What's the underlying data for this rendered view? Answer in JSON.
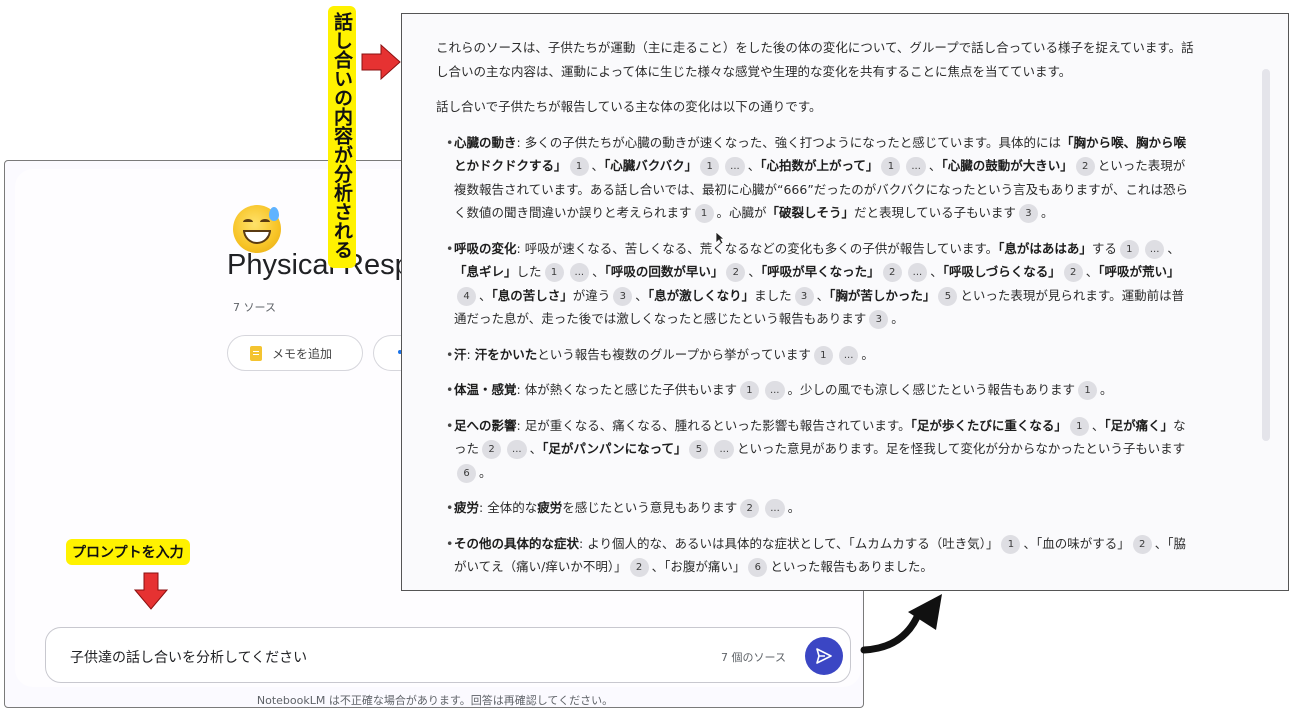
{
  "notebook": {
    "title": "Physical Resp",
    "source_count": "7 ソース",
    "memo_button": "メモを追加",
    "prompt": {
      "value": "子供達の話し合いを分析してください",
      "sources": "7 個のソース"
    },
    "disclaimer": "NotebookLM は不正確な場合があります。回答は再確認してください。"
  },
  "annotations": {
    "input_label": "プロンプトを入力",
    "analysis_label": "話し合いの内容が分析される"
  },
  "response": {
    "intro": "これらのソースは、子供たちが運動（主に走ること）をした後の体の変化について、グループで話し合っている様子を捉えています。話し合いの主な内容は、運動によって体に生じた様々な感覚や生理的な変化を共有することに焦点を当てています。",
    "lead": "話し合いで子供たちが報告している主な体の変化は以下の通りです。",
    "heart": {
      "head": "心臓の動き",
      "t1": ": 多くの子供たちが心臓の動きが速くなった、強く打つようになったと感じています。具体的には",
      "q1": "「胸から喉、胸から喉とかドクドクする」",
      "c1": "1",
      "t2": "、",
      "q2": "「心臓バクバク」",
      "c2": "1",
      "c2b": "...",
      "t3": "、",
      "q3": "「心拍数が上がって」",
      "c3": "1",
      "c3b": "...",
      "t4": "、",
      "q4": "「心臓の鼓動が大きい」",
      "c4": "2",
      "t5": "といった表現が複数報告されています。ある話し合いでは、最初に心臓が“666”だったのがバクバクになったという言及もありますが、これは恐らく数値の聞き間違いか誤りと考えられます",
      "c5": "1",
      "t6": "。心臓が",
      "q5": "「破裂しそう」",
      "t7": "だと表現している子もいます",
      "c6": "3",
      "t8": "。"
    },
    "breath": {
      "head": "呼吸の変化",
      "t1": ": 呼吸が速くなる、苦しくなる、荒くなるなどの変化も多くの子供が報告しています。",
      "q1": "「息がはあはあ」",
      "t2": "する",
      "c1": "1",
      "c1b": "...",
      "t3": "、",
      "q2": "「息ギレ」",
      "t4": "した",
      "c2": "1",
      "c2b": "...",
      "t5": "、",
      "q3": "「呼吸の回数が早い」",
      "c3": "2",
      "t6": "、",
      "q4": "「呼吸が早くなった」",
      "c4": "2",
      "c4b": "...",
      "t7": "、",
      "q5": "「呼吸しづらくなる」",
      "c5": "2",
      "t8": "、",
      "q6": "「呼吸が荒い」",
      "c6": "4",
      "t9": "、",
      "q7": "「息の苦しさ」",
      "t10": "が違う",
      "c7": "3",
      "t11": "、",
      "q8": "「息が激しくなり」",
      "t12": "ました",
      "c8": "3",
      "t13": "、",
      "q9": "「胸が苦しかった」",
      "c9": "5",
      "t14": "といった表現が見られます。運動前は普通だった息が、走った後では激しくなったと感じたという報告もあります",
      "c10": "3",
      "t15": "。"
    },
    "sweat": {
      "head": "汗",
      "t1": ": ",
      "q1": "汗をかいた",
      "t2": "という報告も複数のグループから挙がっています",
      "c1": "1",
      "c1b": "...",
      "t3": "。"
    },
    "temp": {
      "head": "体温・感覚",
      "t1": ": 体が熱くなったと感じた子供もいます",
      "c1": "1",
      "c1b": "...",
      "t2": "。少しの風でも涼しく感じたという報告もあります",
      "c2": "1",
      "t3": "。"
    },
    "legs": {
      "head": "足への影響",
      "t1": ": 足が重くなる、痛くなる、腫れるといった影響も報告されています。",
      "q1": "「足が歩くたびに重くなる」",
      "c1": "1",
      "t2": "、",
      "q2": "「足が痛く」",
      "t3": "なった",
      "c2": "2",
      "c2b": "...",
      "t4": "、",
      "q3": "「足がパンパンになって」",
      "c3": "5",
      "c3b": "...",
      "t5": "といった意見があります。足を怪我して変化が分からなかったという子もいます",
      "c4": "6",
      "t6": "。"
    },
    "fatigue": {
      "head": "疲労",
      "t1": ": 全体的な",
      "q1": "疲労",
      "t2": "を感じたという意見もあります",
      "c1": "2",
      "c1b": "...",
      "t3": "。"
    },
    "other": {
      "head": "その他の具体的な症状",
      "t1": ": より個人的な、あるいは具体的な症状として、「ムカムカする（吐き気）」",
      "c1": "1",
      "t2": "、「血の味がする」",
      "c2": "2",
      "t3": "、「脇がいてえ（痛い/痒いか不明）」",
      "c3": "2",
      "t4": "、「お腹が痛い」",
      "c4": "6",
      "t5": "といった報告もありました。"
    }
  },
  "colors": {
    "label_bg": "#fff200",
    "arrow_red": "#e63232",
    "send_button": "#3b46c4"
  },
  "icons": [
    "smiling-sweat-emoji-icon",
    "document-icon",
    "send-icon",
    "mouse-cursor-icon",
    "red-down-arrow-icon",
    "red-right-arrow-icon",
    "curved-arrow-icon"
  ]
}
